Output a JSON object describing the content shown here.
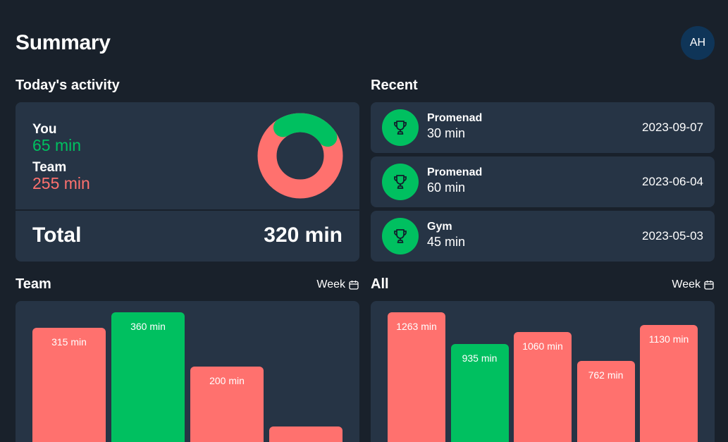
{
  "header": {
    "title": "Summary",
    "avatar_initials": "AH"
  },
  "activity": {
    "title": "Today's activity",
    "you_label": "You",
    "you_value": "65 min",
    "team_label": "Team",
    "team_value": "255 min",
    "total_label": "Total",
    "total_value": "320 min",
    "donut": {
      "you_minutes": 65,
      "team_minutes": 255,
      "you_color": "#00c060",
      "team_color": "#ff716e"
    }
  },
  "recent": {
    "title": "Recent",
    "items": [
      {
        "name": "Promenad",
        "duration": "30 min",
        "date": "2023-09-07",
        "icon": "trophy-icon"
      },
      {
        "name": "Promenad",
        "duration": "60 min",
        "date": "2023-06-04",
        "icon": "trophy-icon"
      },
      {
        "name": "Gym",
        "duration": "45 min",
        "date": "2023-05-03",
        "icon": "trophy-icon"
      }
    ]
  },
  "team_chart": {
    "title": "Team",
    "period": "Week",
    "period_icon": "calendar-icon",
    "bars": [
      {
        "value": 315,
        "label": "315 min",
        "color": "#ff716e"
      },
      {
        "value": 360,
        "label": "360 min",
        "color": "#00c060"
      },
      {
        "value": 200,
        "label": "200 min",
        "color": "#ff716e"
      },
      {
        "value": 25,
        "label": "",
        "color": "#ff716e"
      }
    ]
  },
  "all_chart": {
    "title": "All",
    "period": "Week",
    "period_icon": "calendar-icon",
    "bars": [
      {
        "value": 1263,
        "label": "1263 min",
        "color": "#ff716e"
      },
      {
        "value": 935,
        "label": "935 min",
        "color": "#00c060"
      },
      {
        "value": 1060,
        "label": "1060 min",
        "color": "#ff716e"
      },
      {
        "value": 762,
        "label": "762 min",
        "color": "#ff716e"
      },
      {
        "value": 1130,
        "label": "1130 min",
        "color": "#ff716e"
      }
    ]
  }
}
